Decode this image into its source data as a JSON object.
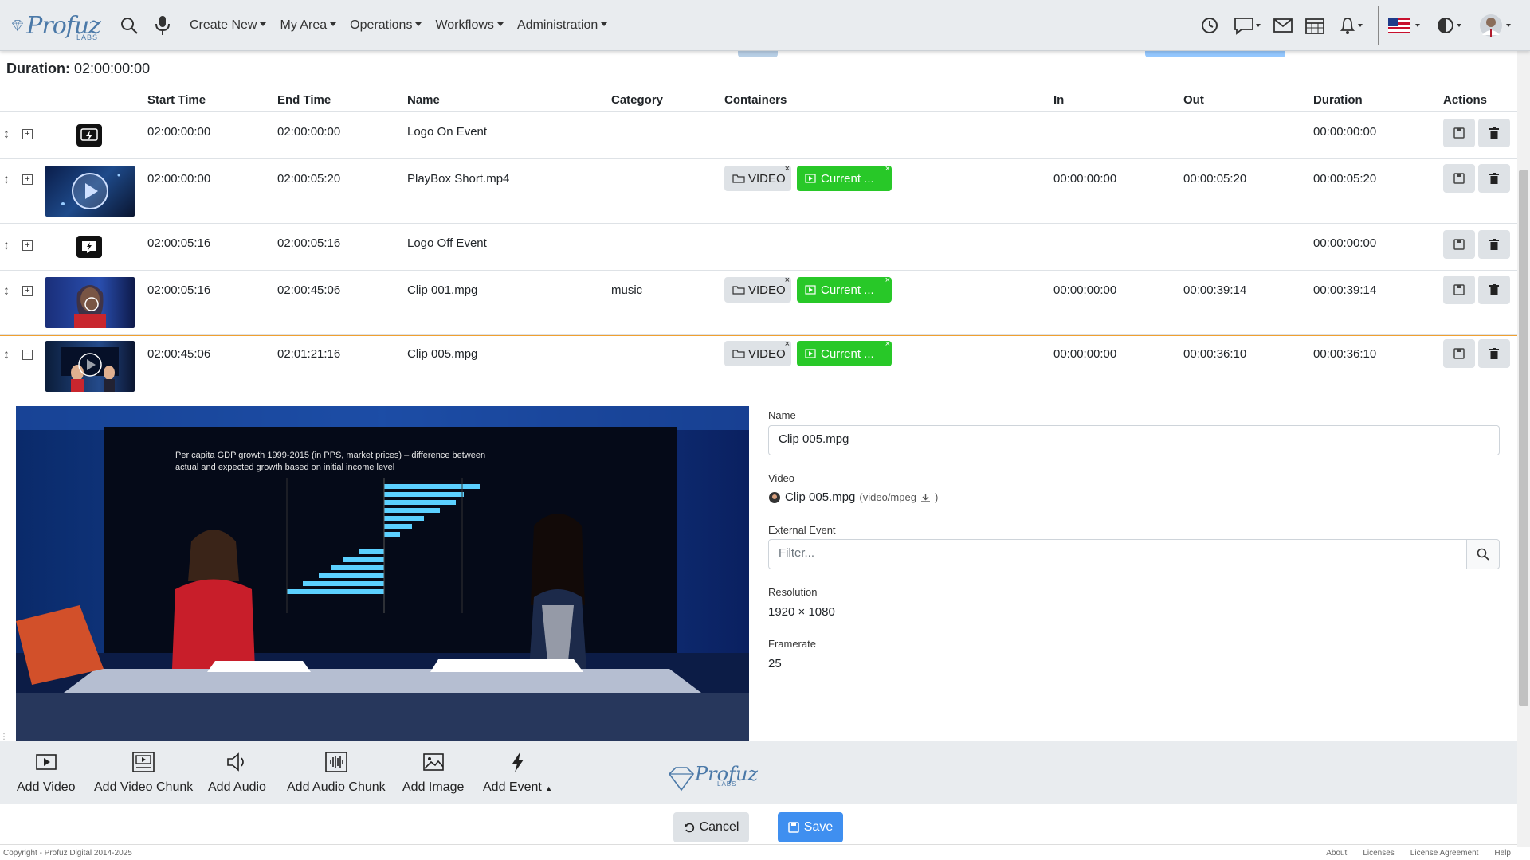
{
  "nav": {
    "brand": "Profuz",
    "brand_sub": "LABS",
    "menus": [
      "Create New",
      "My Area",
      "Operations",
      "Workflows",
      "Administration"
    ]
  },
  "duration": {
    "label": "Duration:",
    "value": "02:00:00:00"
  },
  "table": {
    "headers": {
      "start": "Start Time",
      "end": "End Time",
      "name": "Name",
      "category": "Category",
      "containers": "Containers",
      "in": "In",
      "out": "Out",
      "duration": "Duration",
      "actions": "Actions"
    },
    "rows": [
      {
        "start": "02:00:00:00",
        "end": "02:00:00:00",
        "name": "Logo On Event",
        "category": "",
        "in": "",
        "out": "",
        "duration": "00:00:00:00"
      },
      {
        "start": "02:00:00:00",
        "end": "02:00:05:20",
        "name": "PlayBox Short.mp4",
        "category": "",
        "tag_video": "VIDEO",
        "tag_current": "Current ...",
        "in": "00:00:00:00",
        "out": "00:00:05:20",
        "duration": "00:00:05:20"
      },
      {
        "start": "02:00:05:16",
        "end": "02:00:05:16",
        "name": "Logo Off Event",
        "category": "",
        "in": "",
        "out": "",
        "duration": "00:00:00:00"
      },
      {
        "start": "02:00:05:16",
        "end": "02:00:45:06",
        "name": "Clip 001.mpg",
        "category": "music",
        "tag_video": "VIDEO",
        "tag_current": "Current ...",
        "in": "00:00:00:00",
        "out": "00:00:39:14",
        "duration": "00:00:39:14"
      },
      {
        "start": "02:00:45:06",
        "end": "02:01:21:16",
        "name": "Clip 005.mpg",
        "category": "",
        "tag_video": "VIDEO",
        "tag_current": "Current ...",
        "in": "00:00:00:00",
        "out": "00:00:36:10",
        "duration": "00:00:36:10"
      }
    ]
  },
  "detail": {
    "name_label": "Name",
    "name_value": "Clip 005.mpg",
    "video_label": "Video",
    "video_file": "Clip 005.mpg",
    "video_meta": "(video/mpeg",
    "video_meta_end": ")",
    "external_label": "External Event",
    "external_placeholder": "Filter...",
    "resolution_label": "Resolution",
    "resolution_value": "1920 × 1080",
    "framerate_label": "Framerate",
    "framerate_value": "25",
    "preview_title": "Per capita GDP growth 1999-2015 (in PPS, market prices) – difference between",
    "preview_title2": "actual and expected growth based on initial income level"
  },
  "toolbar": {
    "add_video": "Add Video",
    "add_video_chunk": "Add Video Chunk",
    "add_audio": "Add Audio",
    "add_audio_chunk": "Add Audio Chunk",
    "add_image": "Add Image",
    "add_event": "Add Event",
    "logo": "Profuz",
    "logo_sub": "LABS"
  },
  "buttons": {
    "cancel": "Cancel",
    "save": "Save"
  },
  "footer": {
    "copyright": "Copyright - Profuz Digital 2014-2025",
    "links": [
      "About",
      "Licenses",
      "License Agreement",
      "Help"
    ]
  }
}
